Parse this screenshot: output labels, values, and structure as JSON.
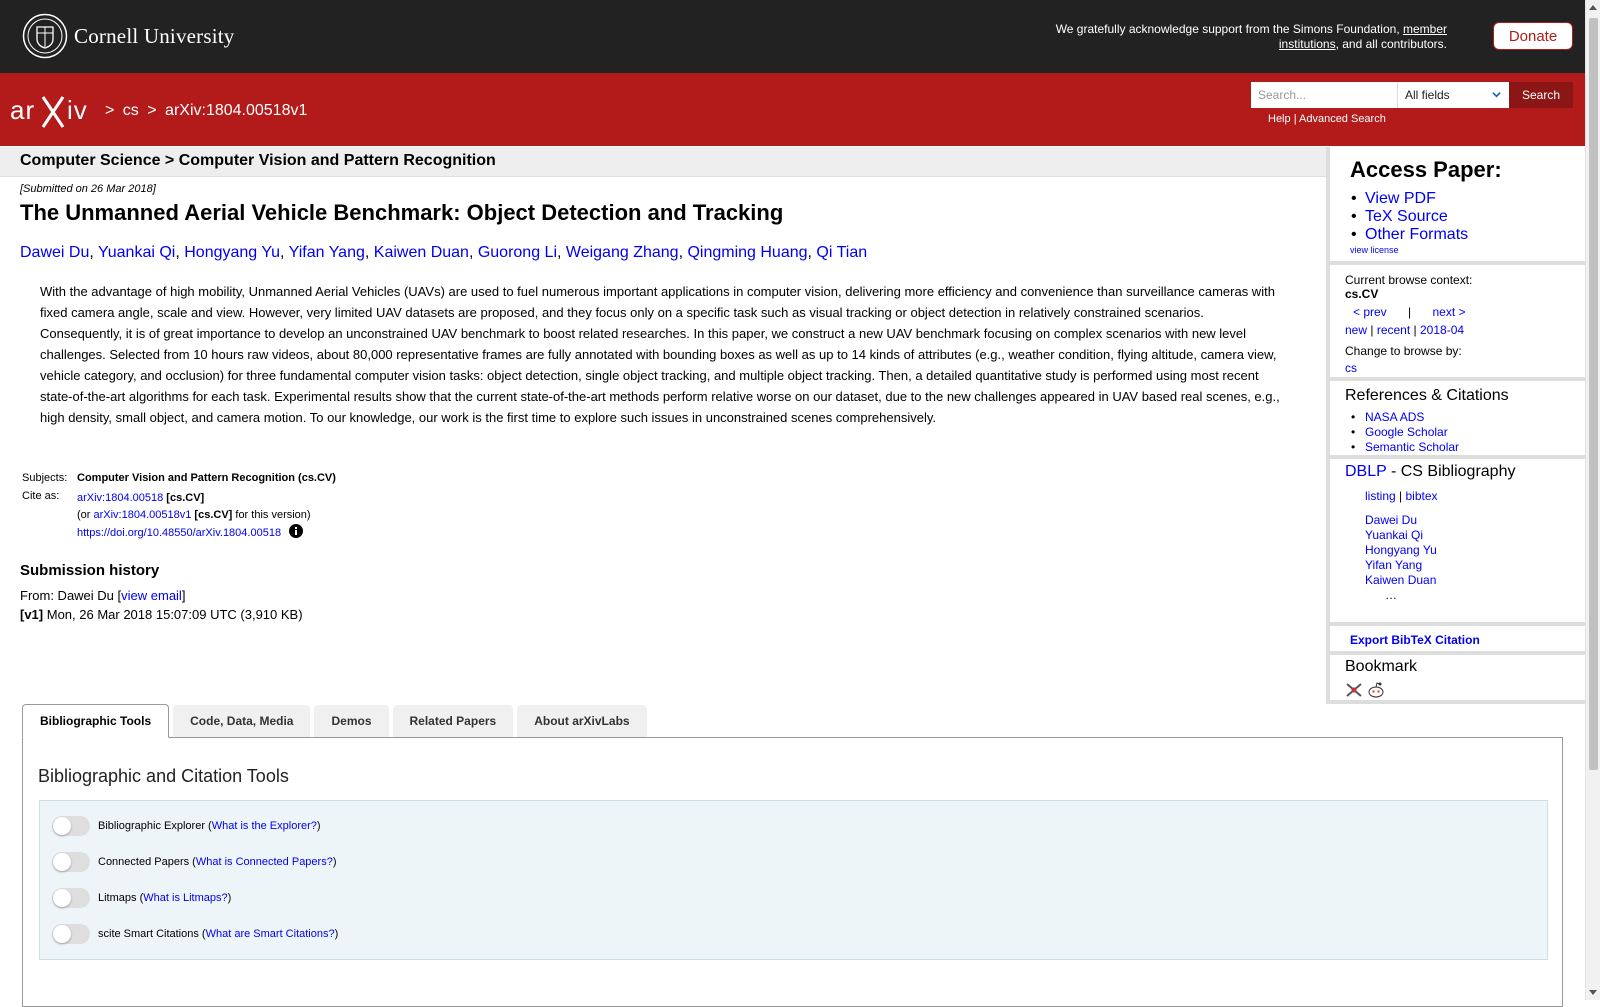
{
  "cornell": {
    "name": "Cornell University",
    "support_pre": "We gratefully acknowledge support from the Simons Foundation, ",
    "support_link": "member institutions",
    "support_post": ", and all contributors.",
    "donate": "Donate"
  },
  "header": {
    "crumbs": [
      ">",
      "cs",
      ">",
      "arXiv:1804.00518v1"
    ],
    "search_placeholder": "Search...",
    "search_field": "All fields",
    "search_button": "Search",
    "help": "Help",
    "sep": "|",
    "advanced": "Advanced Search"
  },
  "category": "Computer Science > Computer Vision and Pattern Recognition",
  "submitted": "[Submitted on 26 Mar 2018]",
  "title": "The Unmanned Aerial Vehicle Benchmark: Object Detection and Tracking",
  "authors": [
    "Dawei Du",
    "Yuankai Qi",
    "Hongyang Yu",
    "Yifan Yang",
    "Kaiwen Duan",
    "Guorong Li",
    "Weigang Zhang",
    "Qingming Huang",
    "Qi Tian"
  ],
  "abstract": "With the advantage of high mobility, Unmanned Aerial Vehicles (UAVs) are used to fuel numerous important applications in computer vision, delivering more efficiency and convenience than surveillance cameras with fixed camera angle, scale and view. However, very limited UAV datasets are proposed, and they focus only on a specific task such as visual tracking or object detection in relatively constrained scenarios. Consequently, it is of great importance to develop an unconstrained UAV benchmark to boost related researches. In this paper, we construct a new UAV benchmark focusing on complex scenarios with new level challenges. Selected from 10 hours raw videos, about 80,000 representative frames are fully annotated with bounding boxes as well as up to 14 kinds of attributes (e.g., weather condition, flying altitude, camera view, vehicle category, and occlusion) for three fundamental computer vision tasks: object detection, single object tracking, and multiple object tracking. Then, a detailed quantitative study is performed using most recent state-of-the-art algorithms for each task. Experimental results show that the current state-of-the-art methods perform relative worse on our dataset, due to the new challenges appeared in UAV based real scenes, e.g., high density, small object, and camera motion. To our knowledge, our work is the first time to explore such issues in unconstrained scenes comprehensively.",
  "meta": {
    "subjects_label": "Subjects:",
    "subjects_value": "Computer Vision and Pattern Recognition (cs.CV)",
    "cite_label": "Cite as:",
    "cite_link": "arXiv:1804.00518",
    "cite_tag": "[cs.CV]",
    "or_pre": "(or ",
    "or_link": "arXiv:1804.00518v1",
    "or_tag": "[cs.CV]",
    "or_post": " for this version)",
    "doi": "https://doi.org/10.48550/arXiv.1804.00518"
  },
  "history": {
    "heading": "Submission history",
    "from_pre": "From: Dawei Du [",
    "from_link": "view email",
    "from_post": "]",
    "v1_label": "[v1]",
    "v1_text": " Mon, 26 Mar 2018 15:07:09 UTC (3,910 KB)"
  },
  "sidebar": {
    "access_title": "Access Paper:",
    "access_links": [
      "View PDF",
      "TeX Source",
      "Other Formats"
    ],
    "view_license": "view license",
    "browse_label": "Current browse context:",
    "browse_value": "cs.CV",
    "prev": "< prev",
    "bar": "|",
    "next": "next >",
    "new": "new",
    "recent": "recent",
    "month": "2018-04",
    "change_label": "Change to browse by:",
    "change_value": "cs",
    "refs_title": "References & Citations",
    "refs": [
      "NASA ADS",
      "Google Scholar",
      "Semantic Scholar"
    ],
    "dblp": "DBLP",
    "dblp_rest": " - CS Bibliography",
    "listing": "listing",
    "bibtex": "bibtex",
    "dblp_authors": [
      "Dawei Du",
      "Yuankai Qi",
      "Hongyang Yu",
      "Yifan Yang",
      "Kaiwen Duan"
    ],
    "ellipsis": "…",
    "export": "Export BibTeX Citation",
    "bookmark": "Bookmark"
  },
  "tabs": [
    "Bibliographic Tools",
    "Code, Data, Media",
    "Demos",
    "Related Papers",
    "About arXivLabs"
  ],
  "tools": {
    "title": "Bibliographic and Citation Tools",
    "rows": [
      {
        "label": "Bibliographic Explorer",
        "link": "What is the Explorer?"
      },
      {
        "label": "Connected Papers",
        "link": "What is Connected Papers?"
      },
      {
        "label": "Litmaps",
        "link": "What is Litmaps?"
      },
      {
        "label": "scite Smart Citations",
        "link": "What are Smart Citations?"
      }
    ]
  },
  "colors": {
    "arxiv_red": "#b31b1b",
    "cornell_bar": "#222222",
    "link": "#0000ee"
  }
}
